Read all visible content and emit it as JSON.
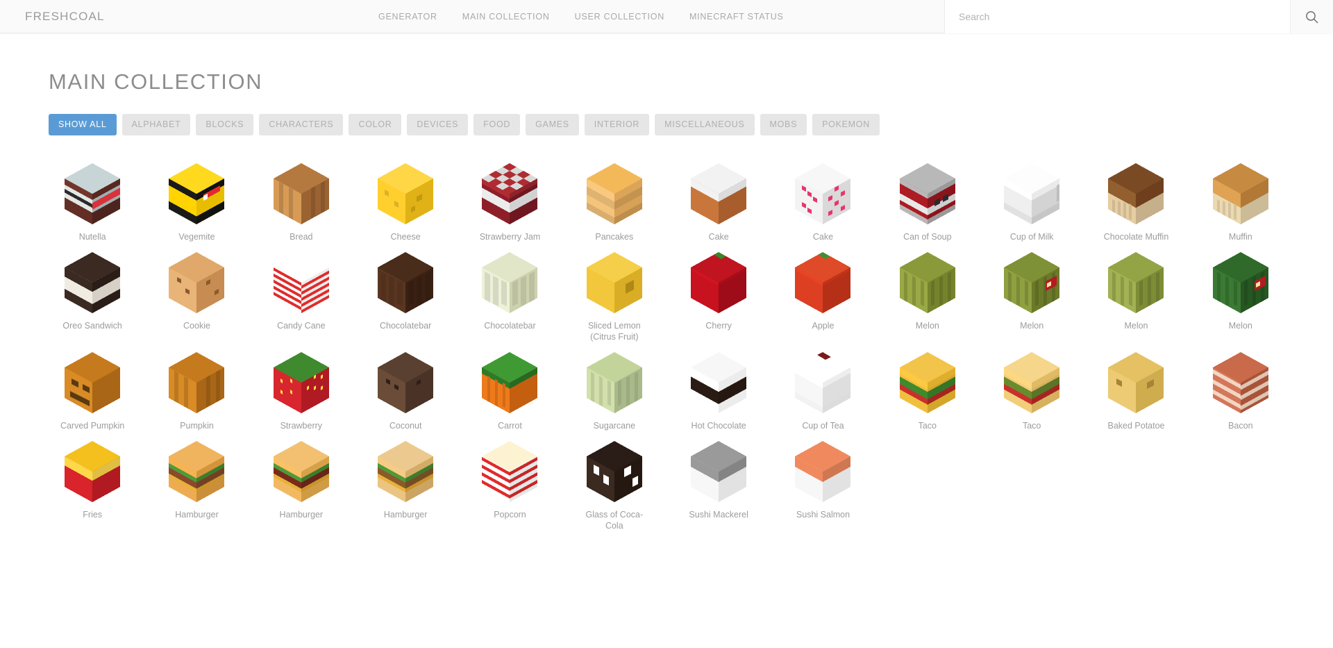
{
  "site": {
    "brand": "FRESHCOAL"
  },
  "nav": {
    "links": [
      {
        "label": "GENERATOR",
        "name": "nav-generator"
      },
      {
        "label": "MAIN COLLECTION",
        "name": "nav-main-collection"
      },
      {
        "label": "USER COLLECTION",
        "name": "nav-user-collection"
      },
      {
        "label": "MINECRAFT STATUS",
        "name": "nav-minecraft-status"
      }
    ]
  },
  "search": {
    "placeholder": "Search",
    "value": "",
    "icon": "search-icon"
  },
  "page": {
    "title": "MAIN COLLECTION"
  },
  "filters": {
    "active": "SHOW ALL",
    "items": [
      {
        "label": "SHOW ALL",
        "active": true
      },
      {
        "label": "ALPHABET",
        "active": false
      },
      {
        "label": "BLOCKS",
        "active": false
      },
      {
        "label": "CHARACTERS",
        "active": false
      },
      {
        "label": "COLOR",
        "active": false
      },
      {
        "label": "DEVICES",
        "active": false
      },
      {
        "label": "FOOD",
        "active": false
      },
      {
        "label": "GAMES",
        "active": false
      },
      {
        "label": "INTERIOR",
        "active": false
      },
      {
        "label": "MISCELLANEOUS",
        "active": false
      },
      {
        "label": "MOBS",
        "active": false
      },
      {
        "label": "POKEMON",
        "active": false
      }
    ]
  },
  "colors": {
    "accent": "#5b9bd5",
    "filter_bg": "#e6e6e6",
    "filter_text": "#b0b0b0",
    "label_text": "#9c9c9c",
    "nav_text": "#a9a9a9",
    "title_text": "#8d8d8d",
    "navbar_bg": "#fafafa"
  },
  "items": [
    {
      "label": "Nutella",
      "top": "#c7d5d6",
      "left": "#e3e7e4",
      "right": "#9fb0b2",
      "accent": "#5a2a22",
      "band": "dark-base",
      "style": "cake"
    },
    {
      "label": "Vegemite",
      "top": "#ffd91e",
      "left": "#ffd400",
      "right": "#e8bd00",
      "accent": "#1a1a18",
      "band": "black-stripes",
      "style": "sandwich"
    },
    {
      "label": "Bread",
      "top": "#b3793f",
      "left": "#d79b56",
      "right": "#9a6331",
      "accent": "#8a5527",
      "band": "ribs",
      "style": "bread"
    },
    {
      "label": "Cheese",
      "top": "#ffd646",
      "left": "#ffcf2e",
      "right": "#e0b216",
      "accent": "#e8b81c",
      "band": "holes",
      "style": "cheese"
    },
    {
      "label": "Strawberry Jam",
      "top": "#d8dbd8",
      "left": "#8e1f28",
      "right": "#6f1720",
      "accent": "#ffffff",
      "band": "checker-lid",
      "style": "jar"
    },
    {
      "label": "Pancakes",
      "top": "#f3b958",
      "left": "#f0c07a",
      "right": "#d39e55",
      "accent": "#e0861f",
      "band": "stack",
      "style": "pancake"
    },
    {
      "label": "Cake",
      "top": "#f2f2f2",
      "left": "#c9763c",
      "right": "#a85d2c",
      "accent": "#d8333a",
      "band": "icing",
      "style": "cake2"
    },
    {
      "label": "Cake",
      "top": "#f7f7f7",
      "left": "#f3f3f3",
      "right": "#d9d9d9",
      "accent": "#e8356d",
      "band": "dots",
      "style": "cake3"
    },
    {
      "label": "Can of Soup",
      "top": "#b8b8b8",
      "left": "#ad1b24",
      "right": "#8b141c",
      "accent": "#e6e6e6",
      "band": "label",
      "style": "can"
    },
    {
      "label": "Cup of Milk",
      "top": "#fdfdfd",
      "left": "#efefef",
      "right": "#d3d3d3",
      "accent": "#cfcfcf",
      "band": "cup",
      "style": "cup"
    },
    {
      "label": "Chocolate Muffin",
      "top": "#7a4a24",
      "left": "#8b5a2c",
      "right": "#6a3c1c",
      "accent": "#e6cda2",
      "band": "muffin",
      "style": "muffin"
    },
    {
      "label": "Muffin",
      "top": "#c78a41",
      "left": "#d59a4f",
      "right": "#a97233",
      "accent": "#ecd9af",
      "band": "muffin",
      "style": "muffin"
    },
    {
      "label": "Oreo Sandwich",
      "top": "#3a2a22",
      "left": "#f0ece4",
      "right": "#d6d0c6",
      "accent": "#2a1c16",
      "band": "oreo",
      "style": "oreo"
    },
    {
      "label": "Cookie",
      "top": "#e0a86a",
      "left": "#e9b478",
      "right": "#c68c52",
      "accent": "#8a5a2a",
      "band": "chips",
      "style": "cookie"
    },
    {
      "label": "Candy Cane",
      "top": "#ffffff",
      "left": "#fafafa",
      "right": "#ededed",
      "accent": "#e02b2b",
      "band": "stripes-diag",
      "style": "candy"
    },
    {
      "label": "Chocolatebar",
      "top": "#4a2c1a",
      "left": "#5a3620",
      "right": "#3a2113",
      "accent": "#2f1a0e",
      "band": "choco",
      "style": "choco"
    },
    {
      "label": "Chocolatebar",
      "top": "#e2e6c8",
      "left": "#eef1d8",
      "right": "#ccd1ae",
      "accent": "#d4d9b4",
      "band": "choco",
      "style": "choco"
    },
    {
      "label": "Sliced Lemon (Citrus Fruit)",
      "top": "#f6cf4a",
      "left": "#f2c73c",
      "right": "#d9ae26",
      "accent": "#c99a18",
      "band": "lemon",
      "style": "lemon"
    },
    {
      "label": "Cherry",
      "top": "#c01420",
      "left": "#c8121f",
      "right": "#9d0c18",
      "accent": "#2f8a2a",
      "band": "fruit",
      "style": "cherry"
    },
    {
      "label": "Apple",
      "top": "#df4a28",
      "left": "#dc3f22",
      "right": "#b63018",
      "accent": "#3e8f35",
      "band": "fruit",
      "style": "apple"
    },
    {
      "label": "Melon",
      "top": "#8a9a3a",
      "left": "#9aa944",
      "right": "#75842c",
      "accent": "#5c6a1e",
      "band": "melon",
      "style": "melon"
    },
    {
      "label": "Melon",
      "top": "#7f9136",
      "left": "#8fa040",
      "right": "#6b7a28",
      "accent": "#b41a22",
      "band": "melon",
      "style": "melon"
    },
    {
      "label": "Melon",
      "top": "#93a446",
      "left": "#a3b252",
      "right": "#7d8c36",
      "accent": "#6a7726",
      "band": "melon",
      "style": "melon"
    },
    {
      "label": "Melon",
      "top": "#2f6a2a",
      "left": "#3a7a33",
      "right": "#265621",
      "accent": "#b41a22",
      "band": "melon",
      "style": "melon"
    },
    {
      "label": "Carved Pumpkin",
      "top": "#c67a1e",
      "left": "#d98b26",
      "right": "#a96616",
      "accent": "#5a3a10",
      "band": "face",
      "style": "pumpkin"
    },
    {
      "label": "Pumpkin",
      "top": "#c67a1e",
      "left": "#d98b26",
      "right": "#a96616",
      "accent": "#9a5e14",
      "band": "ribs",
      "style": "pumpkin"
    },
    {
      "label": "Strawberry",
      "top": "#3f8a2e",
      "left": "#d8262e",
      "right": "#b01a22",
      "accent": "#ffd84a",
      "band": "seeds",
      "style": "strawberry"
    },
    {
      "label": "Coconut",
      "top": "#5a4030",
      "left": "#6a4c38",
      "right": "#4a3326",
      "accent": "#2e2018",
      "band": "coconut",
      "style": "coconut"
    },
    {
      "label": "Carrot",
      "top": "#3f9a34",
      "left": "#ef7a1a",
      "right": "#c45f10",
      "accent": "#2f7a26",
      "band": "carrot",
      "style": "carrot"
    },
    {
      "label": "Sugarcane",
      "top": "#c3d49a",
      "left": "#d2e0ab",
      "right": "#aab98a",
      "accent": "#8fa86a",
      "band": "cane",
      "style": "cane"
    },
    {
      "label": "Hot Chocolate",
      "top": "#f7f7f7",
      "left": "#ffffff",
      "right": "#e4e4e4",
      "accent": "#2a1c14",
      "band": "hotchoc",
      "style": "mug"
    },
    {
      "label": "Cup of Tea",
      "top": "#ffffff",
      "left": "#f7f7f7",
      "right": "#dedede",
      "accent": "#7a1a1a",
      "band": "tea",
      "style": "cup"
    },
    {
      "label": "Taco",
      "top": "#f3c44a",
      "left": "#f0bf3e",
      "right": "#d4a62a",
      "accent": "#3f8a2e",
      "band": "taco",
      "style": "taco"
    },
    {
      "label": "Taco",
      "top": "#f5d68a",
      "left": "#f2ce7a",
      "right": "#d6b160",
      "accent": "#6a8a2e",
      "band": "taco",
      "style": "taco"
    },
    {
      "label": "Baked Potatoe",
      "top": "#e5c164",
      "left": "#edcb74",
      "right": "#cfac4e",
      "accent": "#b3903a",
      "band": "potato",
      "style": "potato"
    },
    {
      "label": "Bacon",
      "top": "#c96a4a",
      "left": "#d4765a",
      "right": "#a8543a",
      "accent": "#f2d6c2",
      "band": "bacon",
      "style": "bacon"
    },
    {
      "label": "Fries",
      "top": "#f4c01e",
      "left": "#d8242a",
      "right": "#b01a20",
      "accent": "#ffd84a",
      "band": "fries",
      "style": "fries"
    },
    {
      "label": "Hamburger",
      "top": "#f0b35e",
      "left": "#e8a94f",
      "right": "#c88c38",
      "accent": "#8a4a2a",
      "band": "burger",
      "style": "burger"
    },
    {
      "label": "Hamburger",
      "top": "#f3c071",
      "left": "#ecb660",
      "right": "#cc9844",
      "accent": "#7a2a1a",
      "band": "burger",
      "style": "burger"
    },
    {
      "label": "Hamburger",
      "top": "#ecc98e",
      "left": "#e6c07e",
      "right": "#c8a262",
      "accent": "#8a5a2a",
      "band": "burger",
      "style": "burger"
    },
    {
      "label": "Popcorn",
      "top": "#fdf3d2",
      "left": "#ffffff",
      "right": "#e6e6e6",
      "accent": "#e02b2b",
      "band": "popcorn",
      "style": "popcorn"
    },
    {
      "label": "Glass of Coca-Cola",
      "top": "#2a1c16",
      "left": "#3a2a20",
      "right": "#241810",
      "accent": "#ffffff",
      "band": "cola",
      "style": "cola"
    },
    {
      "label": "Sushi Mackerel",
      "top": "#9a9a9a",
      "left": "#f4f4f4",
      "right": "#dcdcdc",
      "accent": "#6a6a6a",
      "band": "sushi",
      "style": "sushi"
    },
    {
      "label": "Sushi Salmon",
      "top": "#f08a5e",
      "left": "#f7f7f7",
      "right": "#e2e2e2",
      "accent": "#e06a3e",
      "band": "sushi",
      "style": "sushi"
    }
  ]
}
